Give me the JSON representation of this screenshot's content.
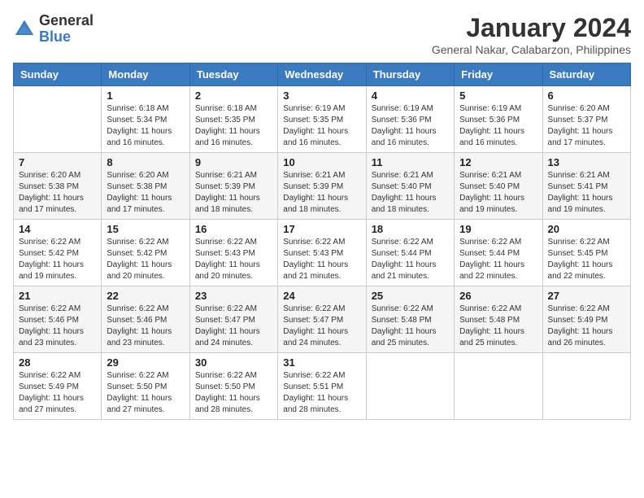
{
  "logo": {
    "general": "General",
    "blue": "Blue"
  },
  "title": "January 2024",
  "location": "General Nakar, Calabarzon, Philippines",
  "weekdays": [
    "Sunday",
    "Monday",
    "Tuesday",
    "Wednesday",
    "Thursday",
    "Friday",
    "Saturday"
  ],
  "weeks": [
    [
      {
        "day": "",
        "info": ""
      },
      {
        "day": "1",
        "info": "Sunrise: 6:18 AM\nSunset: 5:34 PM\nDaylight: 11 hours\nand 16 minutes."
      },
      {
        "day": "2",
        "info": "Sunrise: 6:18 AM\nSunset: 5:35 PM\nDaylight: 11 hours\nand 16 minutes."
      },
      {
        "day": "3",
        "info": "Sunrise: 6:19 AM\nSunset: 5:35 PM\nDaylight: 11 hours\nand 16 minutes."
      },
      {
        "day": "4",
        "info": "Sunrise: 6:19 AM\nSunset: 5:36 PM\nDaylight: 11 hours\nand 16 minutes."
      },
      {
        "day": "5",
        "info": "Sunrise: 6:19 AM\nSunset: 5:36 PM\nDaylight: 11 hours\nand 16 minutes."
      },
      {
        "day": "6",
        "info": "Sunrise: 6:20 AM\nSunset: 5:37 PM\nDaylight: 11 hours\nand 17 minutes."
      }
    ],
    [
      {
        "day": "7",
        "info": "Sunrise: 6:20 AM\nSunset: 5:38 PM\nDaylight: 11 hours\nand 17 minutes."
      },
      {
        "day": "8",
        "info": "Sunrise: 6:20 AM\nSunset: 5:38 PM\nDaylight: 11 hours\nand 17 minutes."
      },
      {
        "day": "9",
        "info": "Sunrise: 6:21 AM\nSunset: 5:39 PM\nDaylight: 11 hours\nand 18 minutes."
      },
      {
        "day": "10",
        "info": "Sunrise: 6:21 AM\nSunset: 5:39 PM\nDaylight: 11 hours\nand 18 minutes."
      },
      {
        "day": "11",
        "info": "Sunrise: 6:21 AM\nSunset: 5:40 PM\nDaylight: 11 hours\nand 18 minutes."
      },
      {
        "day": "12",
        "info": "Sunrise: 6:21 AM\nSunset: 5:40 PM\nDaylight: 11 hours\nand 19 minutes."
      },
      {
        "day": "13",
        "info": "Sunrise: 6:21 AM\nSunset: 5:41 PM\nDaylight: 11 hours\nand 19 minutes."
      }
    ],
    [
      {
        "day": "14",
        "info": "Sunrise: 6:22 AM\nSunset: 5:42 PM\nDaylight: 11 hours\nand 19 minutes."
      },
      {
        "day": "15",
        "info": "Sunrise: 6:22 AM\nSunset: 5:42 PM\nDaylight: 11 hours\nand 20 minutes."
      },
      {
        "day": "16",
        "info": "Sunrise: 6:22 AM\nSunset: 5:43 PM\nDaylight: 11 hours\nand 20 minutes."
      },
      {
        "day": "17",
        "info": "Sunrise: 6:22 AM\nSunset: 5:43 PM\nDaylight: 11 hours\nand 21 minutes."
      },
      {
        "day": "18",
        "info": "Sunrise: 6:22 AM\nSunset: 5:44 PM\nDaylight: 11 hours\nand 21 minutes."
      },
      {
        "day": "19",
        "info": "Sunrise: 6:22 AM\nSunset: 5:44 PM\nDaylight: 11 hours\nand 22 minutes."
      },
      {
        "day": "20",
        "info": "Sunrise: 6:22 AM\nSunset: 5:45 PM\nDaylight: 11 hours\nand 22 minutes."
      }
    ],
    [
      {
        "day": "21",
        "info": "Sunrise: 6:22 AM\nSunset: 5:46 PM\nDaylight: 11 hours\nand 23 minutes."
      },
      {
        "day": "22",
        "info": "Sunrise: 6:22 AM\nSunset: 5:46 PM\nDaylight: 11 hours\nand 23 minutes."
      },
      {
        "day": "23",
        "info": "Sunrise: 6:22 AM\nSunset: 5:47 PM\nDaylight: 11 hours\nand 24 minutes."
      },
      {
        "day": "24",
        "info": "Sunrise: 6:22 AM\nSunset: 5:47 PM\nDaylight: 11 hours\nand 24 minutes."
      },
      {
        "day": "25",
        "info": "Sunrise: 6:22 AM\nSunset: 5:48 PM\nDaylight: 11 hours\nand 25 minutes."
      },
      {
        "day": "26",
        "info": "Sunrise: 6:22 AM\nSunset: 5:48 PM\nDaylight: 11 hours\nand 25 minutes."
      },
      {
        "day": "27",
        "info": "Sunrise: 6:22 AM\nSunset: 5:49 PM\nDaylight: 11 hours\nand 26 minutes."
      }
    ],
    [
      {
        "day": "28",
        "info": "Sunrise: 6:22 AM\nSunset: 5:49 PM\nDaylight: 11 hours\nand 27 minutes."
      },
      {
        "day": "29",
        "info": "Sunrise: 6:22 AM\nSunset: 5:50 PM\nDaylight: 11 hours\nand 27 minutes."
      },
      {
        "day": "30",
        "info": "Sunrise: 6:22 AM\nSunset: 5:50 PM\nDaylight: 11 hours\nand 28 minutes."
      },
      {
        "day": "31",
        "info": "Sunrise: 6:22 AM\nSunset: 5:51 PM\nDaylight: 11 hours\nand 28 minutes."
      },
      {
        "day": "",
        "info": ""
      },
      {
        "day": "",
        "info": ""
      },
      {
        "day": "",
        "info": ""
      }
    ]
  ]
}
